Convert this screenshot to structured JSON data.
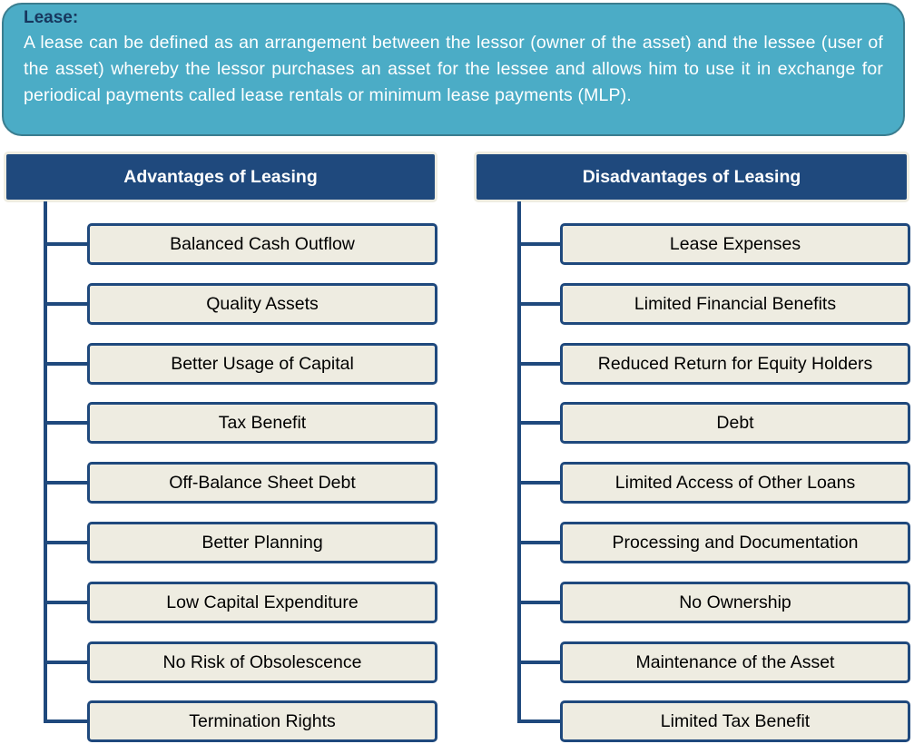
{
  "definition": {
    "title": "Lease:",
    "text": "A lease can be defined as an arrangement between the lessor (owner of the asset) and the lessee (user of the asset) whereby the lessor purchases an asset for the lessee and allows him to use it in exchange for periodical payments called lease rentals or minimum lease payments (MLP)."
  },
  "advantages": {
    "header": "Advantages of Leasing",
    "items": [
      "Balanced Cash Outflow",
      "Quality Assets",
      "Better Usage of Capital",
      "Tax Benefit",
      "Off-Balance Sheet Debt",
      "Better Planning",
      "Low Capital Expenditure",
      "No Risk of Obsolescence",
      "Termination Rights"
    ]
  },
  "disadvantages": {
    "header": "Disadvantages of Leasing",
    "items": [
      "Lease Expenses",
      "Limited Financial Benefits",
      "Reduced Return for Equity Holders",
      "Debt",
      "Limited Access of Other Loans",
      "Processing and Documentation",
      "No Ownership",
      "Maintenance of the Asset",
      "Limited Tax Benefit"
    ]
  },
  "colors": {
    "definition_fill": "#4bacc6",
    "header_fill": "#1f497d",
    "item_fill": "#eeece1",
    "connector": "#1f497d"
  }
}
